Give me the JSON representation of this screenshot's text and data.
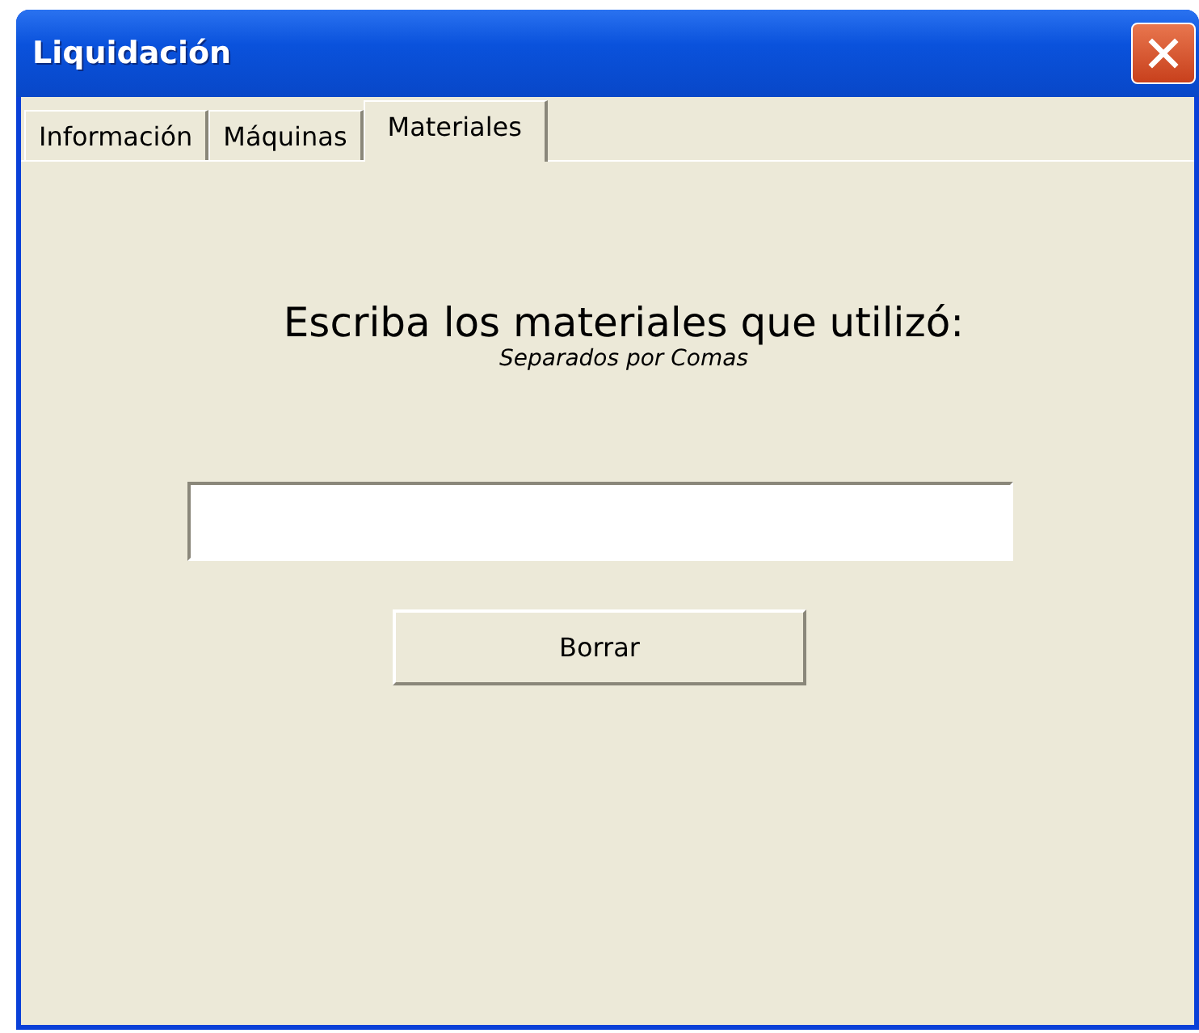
{
  "window": {
    "title": "Liquidación"
  },
  "tabs": [
    {
      "label": "Información",
      "selected": false
    },
    {
      "label": "Máquinas",
      "selected": false
    },
    {
      "label": "Materiales",
      "selected": true
    }
  ],
  "heading": "Escriba los materiales que utilizó:",
  "subheading": "Separados por Comas",
  "buttons": [
    "Borrar"
  ]
}
